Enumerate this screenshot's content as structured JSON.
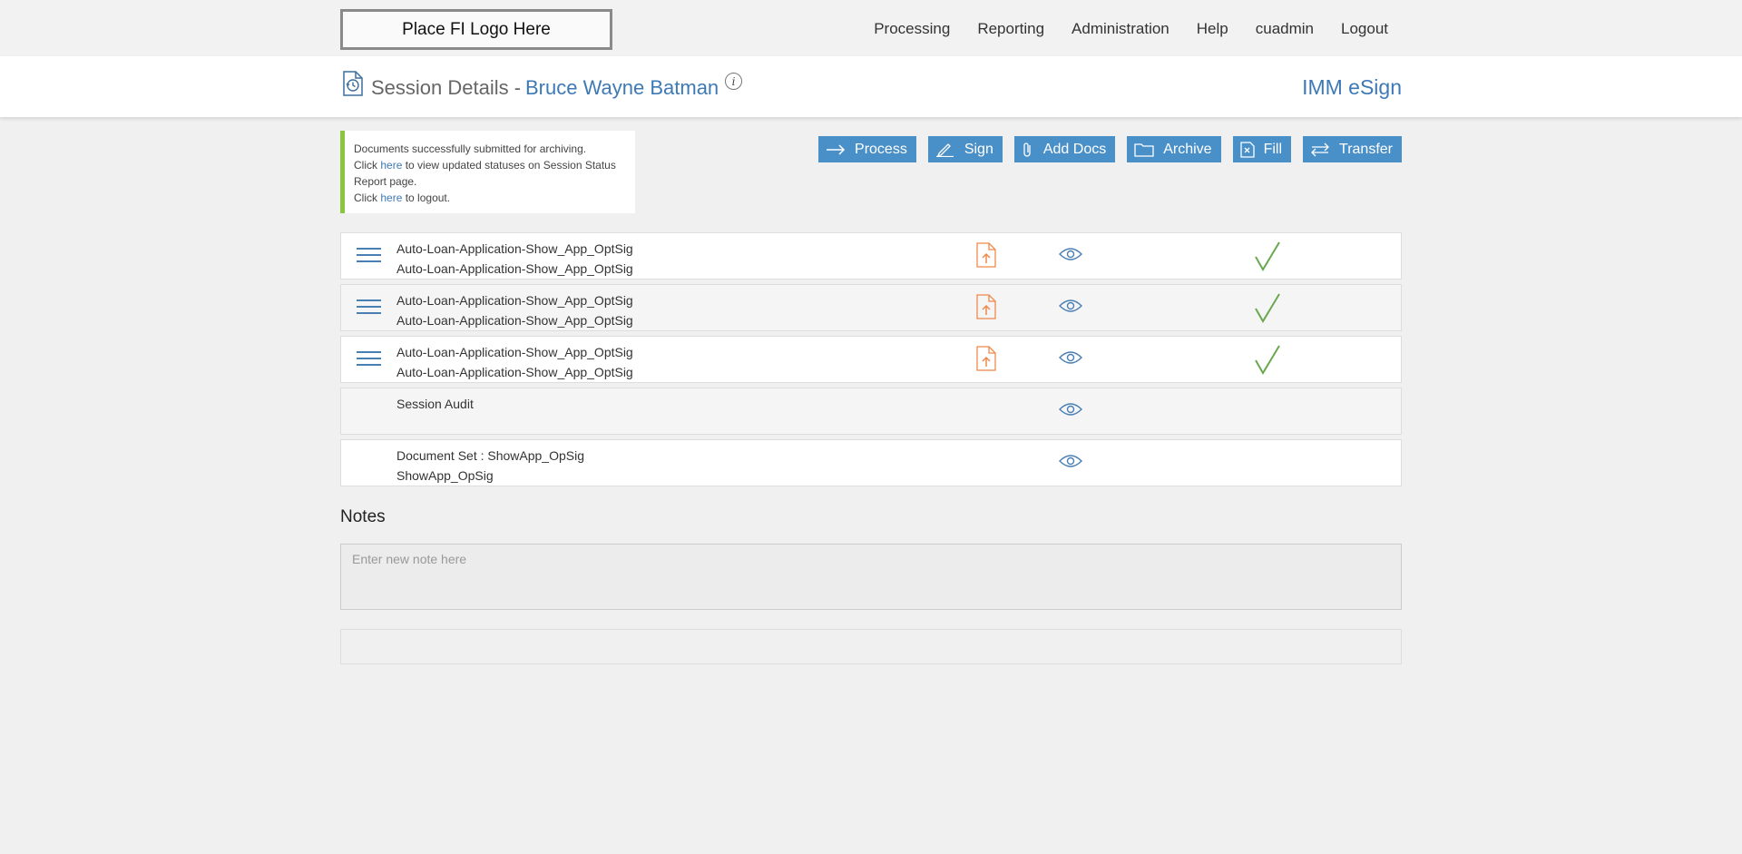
{
  "header": {
    "logo_text": "Place FI Logo Here",
    "nav": [
      "Processing",
      "Reporting",
      "Administration",
      "Help",
      "cuadmin",
      "Logout"
    ]
  },
  "session": {
    "title_label": "Session Details -",
    "customer_name": "Bruce Wayne Batman",
    "info_glyph": "i",
    "brand": "IMM eSign"
  },
  "alert": {
    "line1": "Documents successfully submitted for archiving.",
    "line2_prefix": "Click ",
    "link_text": "here",
    "line2_suffix": " to view updated statuses on Session Status Report page.",
    "line3_prefix": "Click ",
    "line3_suffix": " to logout."
  },
  "actions": [
    "Process",
    "Sign",
    "Add Docs",
    "Archive",
    "Fill",
    "Transfer"
  ],
  "documents": [
    {
      "line1": "Auto-Loan-Application-Show_App_OptSig",
      "line2": "Auto-Loan-Application-Show_App_OptSig",
      "status": "signed"
    },
    {
      "line1": "Auto-Loan-Application-Show_App_OptSig",
      "line2": "Auto-Loan-Application-Show_App_OptSig",
      "status": "signed"
    },
    {
      "line1": "Auto-Loan-Application-Show_App_OptSig",
      "line2": "Auto-Loan-Application-Show_App_OptSig",
      "status": "signed"
    },
    {
      "line1": "Session Audit",
      "line2": ""
    },
    {
      "line1": "Document Set : ShowApp_OpSig",
      "line2": "ShowApp_OpSig"
    }
  ],
  "notes": {
    "label": "Notes",
    "placeholder": "Enter new note here"
  },
  "colors": {
    "accent": "#4a90c8",
    "link": "#3d7ab5",
    "success": "#8cc63f",
    "pdf": "#f0884a",
    "check": "#6aa84f"
  }
}
